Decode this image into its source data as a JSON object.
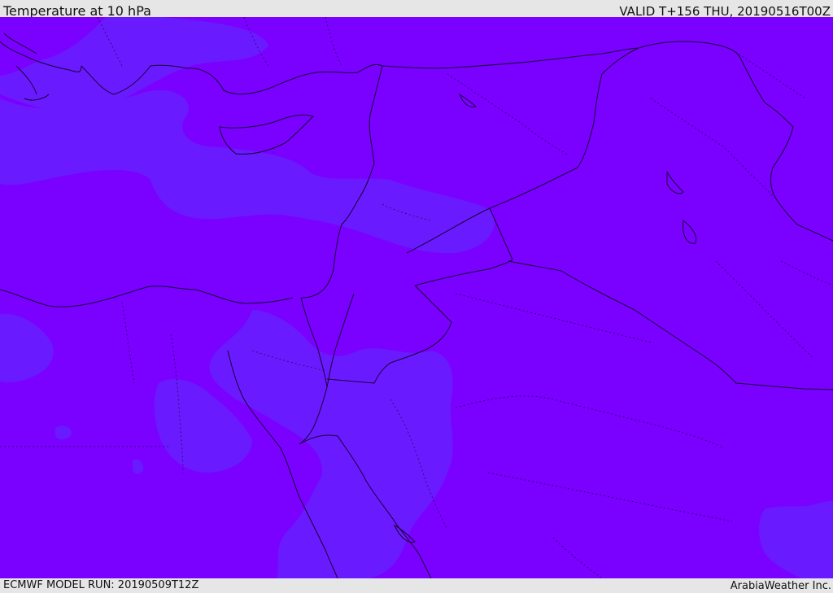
{
  "header": {
    "title": "Temperature at 10 hPa",
    "valid": "VALID T+156 THU, 20190516T00Z"
  },
  "footer": {
    "model_run": "ECMWF MODEL RUN: 20190509T12Z",
    "credit": "ArabiaWeather Inc."
  },
  "map": {
    "field_colors": {
      "warm_band": "#7a00ff",
      "cool_band": "#6a1aff"
    },
    "border_color": "#1a0033"
  }
}
